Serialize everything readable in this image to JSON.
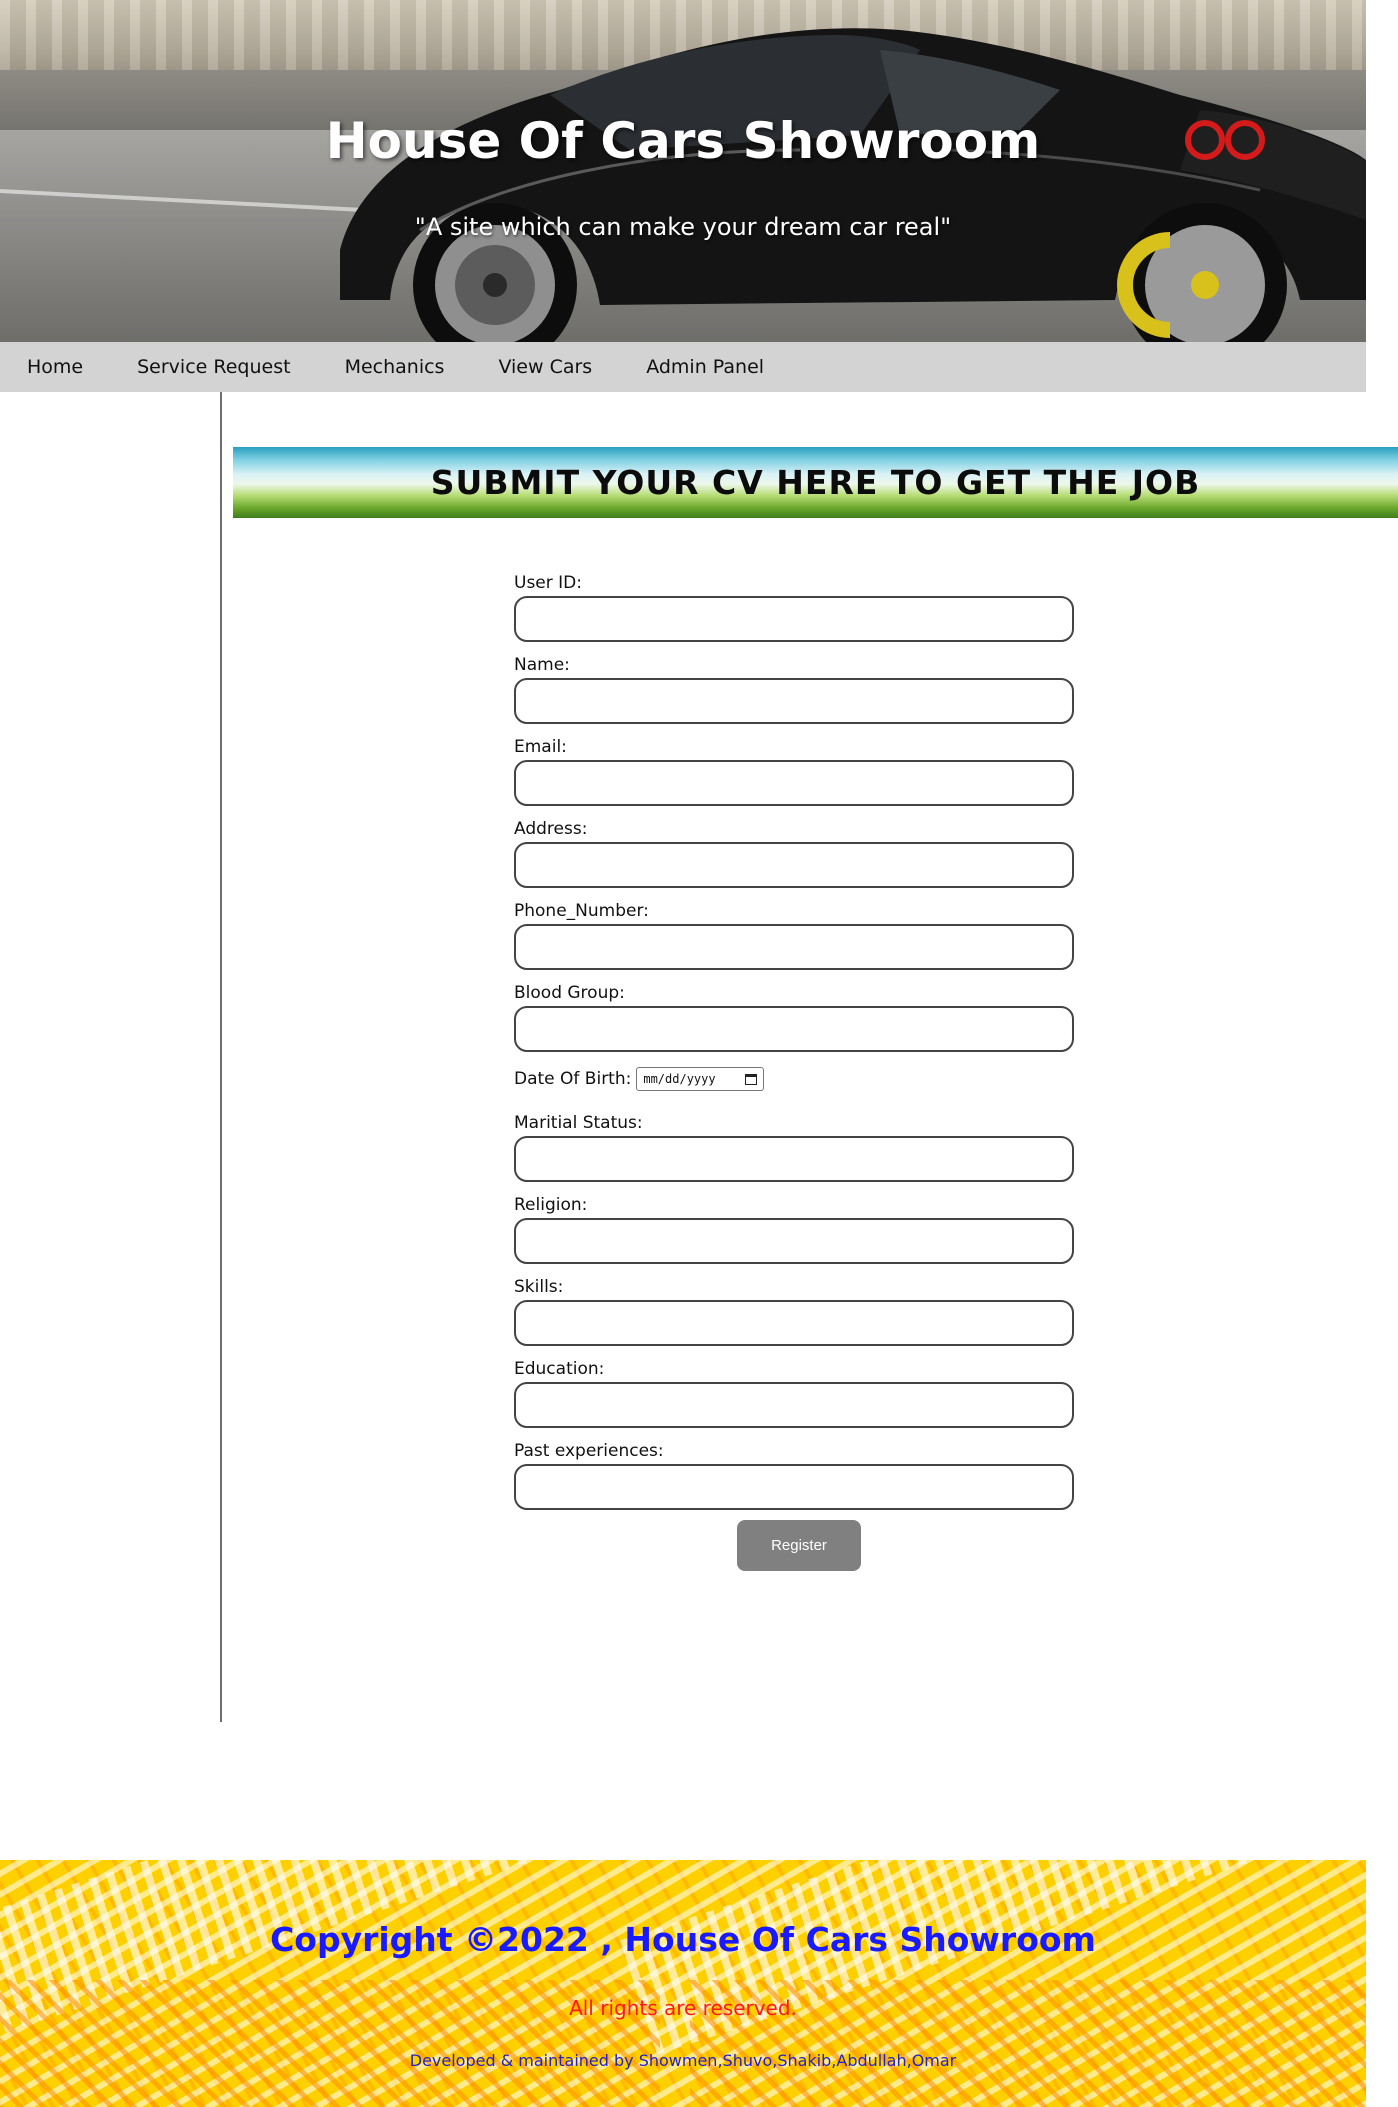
{
  "header": {
    "title": "House Of Cars Showroom",
    "subtitle": "\"A site which can make your dream car real\""
  },
  "nav": {
    "items": [
      {
        "label": "Home"
      },
      {
        "label": "Service Request"
      },
      {
        "label": "Mechanics"
      },
      {
        "label": "View Cars"
      },
      {
        "label": "Admin Panel"
      }
    ]
  },
  "banner": {
    "heading": "SUBMIT YOUR CV HERE TO GET THE JOB"
  },
  "form": {
    "fields": [
      {
        "label": "User ID:",
        "value": ""
      },
      {
        "label": "Name:",
        "value": ""
      },
      {
        "label": "Email:",
        "value": ""
      },
      {
        "label": "Address:",
        "value": ""
      },
      {
        "label": "Phone_Number:",
        "value": ""
      },
      {
        "label": "Blood Group:",
        "value": ""
      }
    ],
    "dob": {
      "label": "Date Of Birth:",
      "placeholder": "mm/dd/yyyy"
    },
    "fields2": [
      {
        "label": "Maritial Status:",
        "value": ""
      },
      {
        "label": "Religion:",
        "value": ""
      },
      {
        "label": "Skills:",
        "value": ""
      },
      {
        "label": "Education:",
        "value": ""
      },
      {
        "label": "Past experiences:",
        "value": ""
      }
    ],
    "submit_label": "Register"
  },
  "footer": {
    "copyright": "Copyright ©2022 , House Of Cars Showroom",
    "rights": "All rights are reserved.",
    "developers": "Developed & maintained by Showmen,Shuvo,Shakib,Abdullah,Omar"
  },
  "colors": {
    "nav_bg": "#d3d3d3",
    "button_bg": "#808080",
    "footer_bg": "#ffd000",
    "footer_copyright": "#1a1aff",
    "footer_rights": "#ff1a1a"
  }
}
